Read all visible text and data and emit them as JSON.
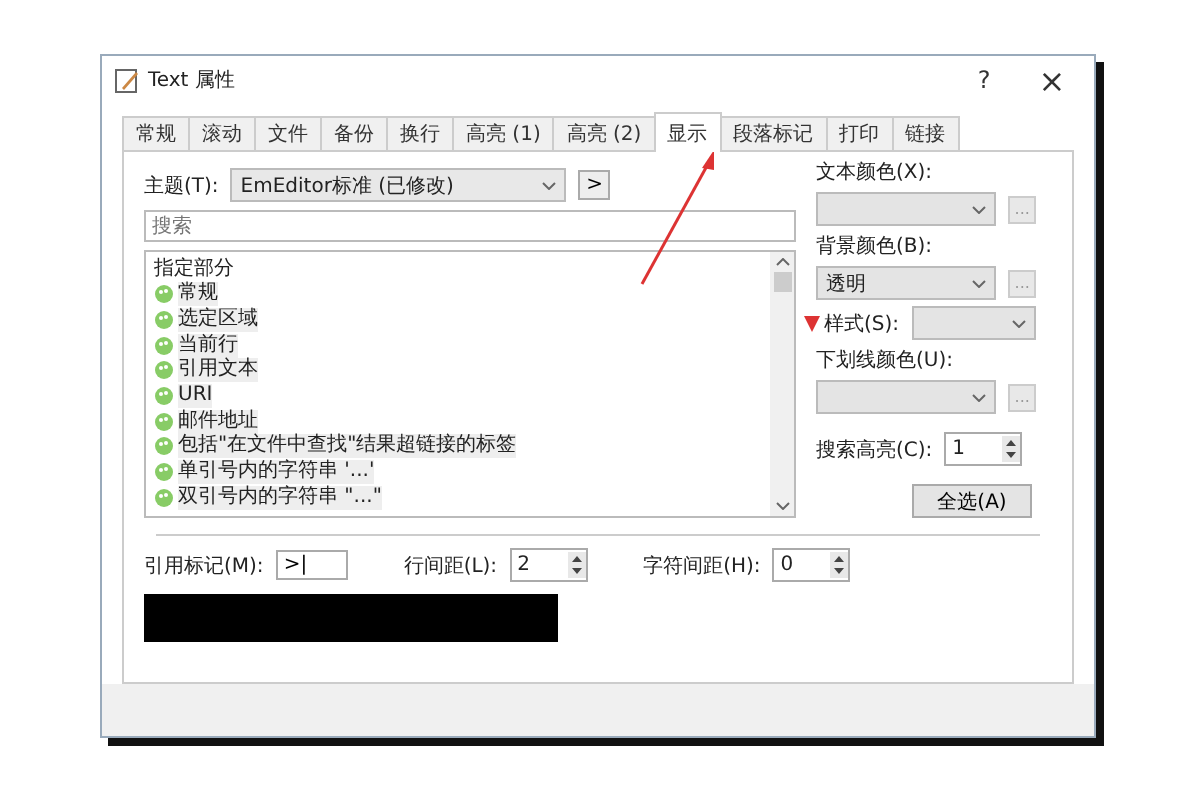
{
  "window": {
    "title": "Text 属性",
    "help": "?",
    "close": "×"
  },
  "tabs": [
    {
      "label": "常规",
      "selected": false
    },
    {
      "label": "滚动",
      "selected": false
    },
    {
      "label": "文件",
      "selected": false
    },
    {
      "label": "备份",
      "selected": false
    },
    {
      "label": "换行",
      "selected": false
    },
    {
      "label": "高亮 (1)",
      "selected": false
    },
    {
      "label": "高亮 (2)",
      "selected": false
    },
    {
      "label": "显示",
      "selected": true
    },
    {
      "label": "段落标记",
      "selected": false
    },
    {
      "label": "打印",
      "selected": false
    },
    {
      "label": "链接",
      "selected": false
    }
  ],
  "theme": {
    "label": "主题(T):",
    "value": "EmEditor标准 (已修改)",
    "next": ">"
  },
  "search": {
    "placeholder": "搜索"
  },
  "list": {
    "header": "指定部分",
    "items": [
      "常规",
      "选定区域",
      "当前行",
      "引用文本",
      "URI",
      "邮件地址",
      "包括\"在文件中查找\"结果超链接的标签",
      "单引号内的字符串 '...'",
      "双引号内的字符串 \"...\""
    ]
  },
  "text_color": {
    "label": "文本颜色(X):",
    "browse": "..."
  },
  "background_color": {
    "label": "背景颜色(B):",
    "value": "透明",
    "browse": "..."
  },
  "style": {
    "label": "样式(S):"
  },
  "underline_color": {
    "label": "下划线颜色(U):",
    "browse": "..."
  },
  "search_highlight": {
    "label": "搜索高亮(C):",
    "value": "1"
  },
  "select_all": "全选(A)",
  "quote_mark": {
    "label": "引用标记(M):",
    "value": ">|"
  },
  "line_spacing": {
    "label": "行间距(L):",
    "value": "2"
  },
  "char_spacing": {
    "label": "字符间距(H):",
    "value": "0"
  }
}
